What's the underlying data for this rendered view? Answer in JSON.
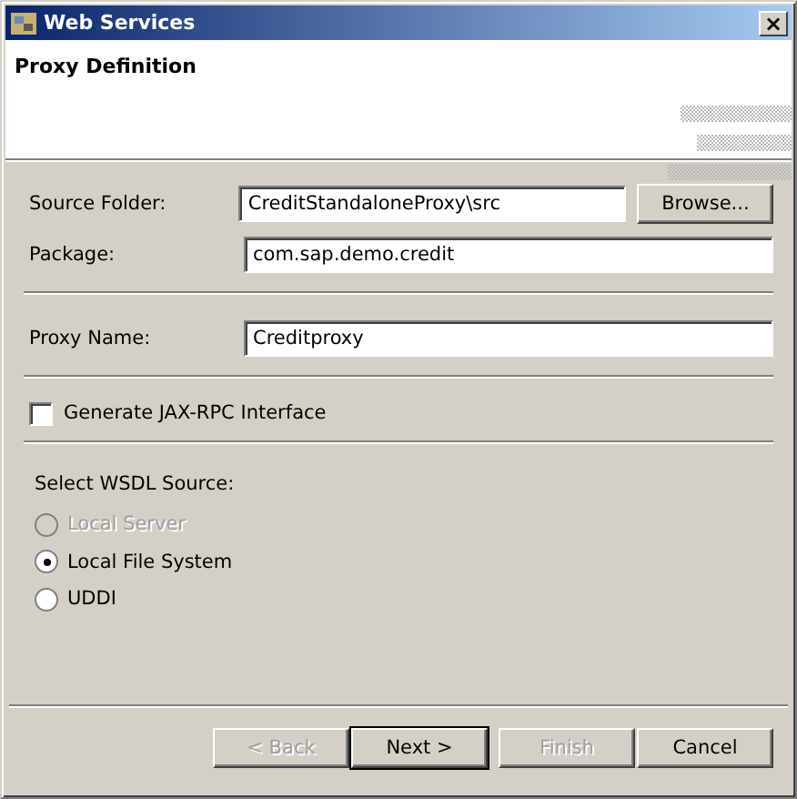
{
  "window": {
    "title": "Web Services",
    "close": "×"
  },
  "header": {
    "title": "Proxy Definition"
  },
  "field_groups": [
    [
      {
        "label": "Source Folder:",
        "value": "CreditStandaloneProxy\\src",
        "button": "Browse..."
      },
      {
        "label": "Package:",
        "value": "com.sap.demo.credit"
      }
    ],
    [
      {
        "label": "Proxy Name:",
        "value": "Creditproxy"
      }
    ]
  ],
  "generate_checkbox": {
    "label": "Generate JAX-RPC Interface",
    "checked": false
  },
  "wsdl_source": {
    "label": "Select WSDL Source:",
    "options": [
      {
        "label": "Local Server",
        "selected": false,
        "disabled": true
      },
      {
        "label": "Local File System",
        "selected": true,
        "disabled": false
      },
      {
        "label": "UDDI",
        "selected": false,
        "disabled": false
      }
    ]
  },
  "buttons": [
    {
      "label": "< Back",
      "disabled": true,
      "default": false
    },
    {
      "label": "Next >",
      "disabled": false,
      "default": true
    },
    {
      "label": "Finish",
      "disabled": true,
      "default": false
    },
    {
      "label": "Cancel",
      "disabled": false,
      "default": false
    }
  ]
}
